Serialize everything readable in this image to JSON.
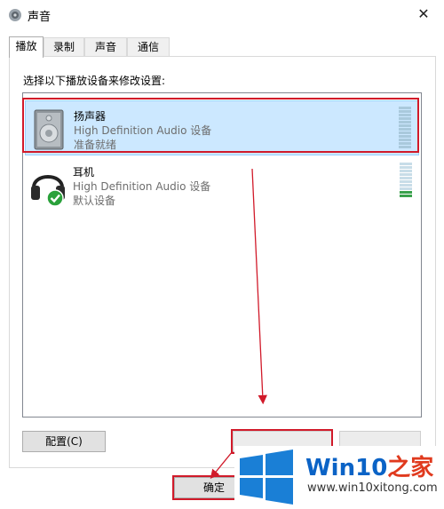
{
  "window": {
    "title": "声音",
    "close_glyph": "✕"
  },
  "tabs": [
    {
      "label": "播放",
      "active": true
    },
    {
      "label": "录制",
      "active": false
    },
    {
      "label": "声音",
      "active": false
    },
    {
      "label": "通信",
      "active": false
    }
  ],
  "instruction": "选择以下播放设备来修改设置:",
  "devices": [
    {
      "name": "扬声器",
      "description": "High Definition Audio 设备",
      "status": "准备就绪",
      "icon": "speaker-icon",
      "selected": true
    },
    {
      "name": "耳机",
      "description": "High Definition Audio 设备",
      "status": "默认设备",
      "icon": "headphones-icon",
      "selected": false
    }
  ],
  "buttons": {
    "configure": "配置(C)",
    "ok": "确定"
  },
  "watermark": {
    "brand_prefix": "Win10",
    "brand_suffix": "之家",
    "url": "www.win10xitong.com"
  },
  "colors": {
    "selection": "#cce8ff",
    "highlight_box": "#d11a2a",
    "default_check": "#2aa13b",
    "brand_blue": "#0b63c6"
  }
}
